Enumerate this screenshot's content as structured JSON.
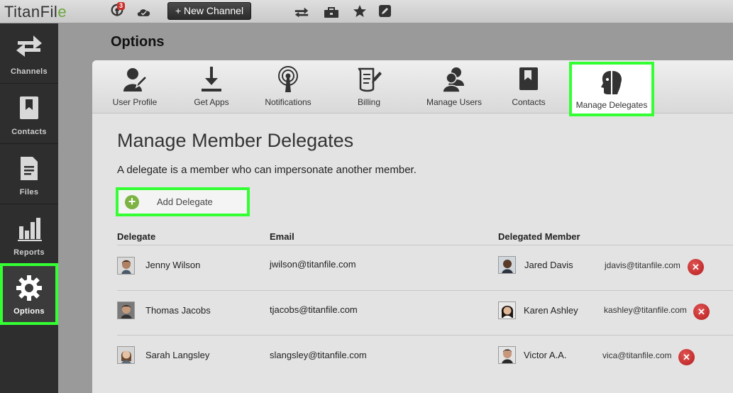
{
  "topbar": {
    "logo": "TitanFile",
    "notification_count": "3",
    "new_channel_label": "+ New Channel"
  },
  "sidebar": {
    "items": [
      {
        "label": "Channels",
        "icon": "arrows-swap-icon"
      },
      {
        "label": "Contacts",
        "icon": "bookmark-book-icon"
      },
      {
        "label": "Files",
        "icon": "document-icon"
      },
      {
        "label": "Reports",
        "icon": "bar-chart-icon"
      },
      {
        "label": "Options",
        "icon": "gear-icon"
      }
    ],
    "active": "Options"
  },
  "page_title": "Options",
  "tabs": [
    {
      "label": "User Profile",
      "icon": "user-edit-icon"
    },
    {
      "label": "Get Apps",
      "icon": "download-icon"
    },
    {
      "label": "Notifications",
      "icon": "broadcast-icon"
    },
    {
      "label": "Billing",
      "icon": "scroll-pen-icon"
    },
    {
      "label": "Manage Users",
      "icon": "users-icon"
    },
    {
      "label": "Contacts",
      "icon": "book-icon"
    },
    {
      "label": "Manage Delegates",
      "icon": "delegate-face-icon"
    }
  ],
  "main": {
    "heading": "Manage Member Delegates",
    "description": "A delegate is a member who can impersonate another member.",
    "add_button": "Add Delegate",
    "columns": [
      "Delegate",
      "Email",
      "Delegated Member"
    ],
    "rows": [
      {
        "delegate": "Jenny Wilson",
        "email": "jwilson@titanfile.com",
        "member": "Jared Davis",
        "member_email": "jdavis@titanfile.com"
      },
      {
        "delegate": "Thomas Jacobs",
        "email": "tjacobs@titanfile.com",
        "member": "Karen Ashley",
        "member_email": "kashley@titanfile.com"
      },
      {
        "delegate": "Sarah Langsley",
        "email": "slangsley@titanfile.com",
        "member": "Victor A.A.",
        "member_email": "vica@titanfile.com"
      }
    ]
  },
  "colors": {
    "highlight": "#33ff33",
    "accent_green": "#7cb342",
    "delete_red": "#c62828"
  }
}
